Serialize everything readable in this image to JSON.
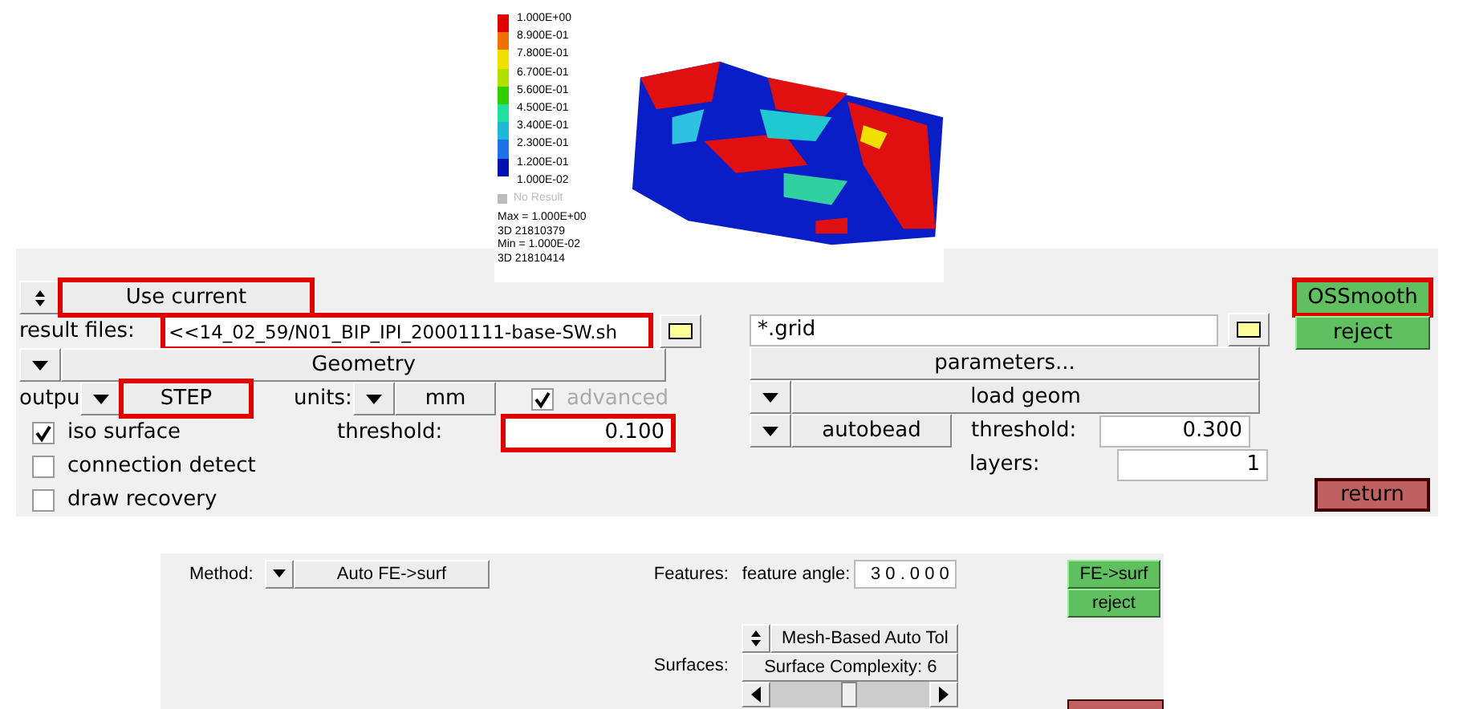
{
  "contour_plot": {
    "legend_labels": [
      "1.000E+00",
      "8.900E-01",
      "7.800E-01",
      "6.700E-01",
      "5.600E-01",
      "4.500E-01",
      "3.400E-01",
      "2.300E-01",
      "1.200E-01",
      "1.000E-02"
    ],
    "legend_bands": [
      {
        "color": "#e00000"
      },
      {
        "color": "#f07000"
      },
      {
        "color": "#f0e000"
      },
      {
        "color": "#b0e000"
      },
      {
        "color": "#30d000"
      },
      {
        "color": "#20e0a0"
      },
      {
        "color": "#20b8d8"
      },
      {
        "color": "#2070e8"
      },
      {
        "color": "#0010b0"
      }
    ],
    "no_result": "No Result",
    "stats": [
      "Max = 1.000E+00",
      "3D 21810379",
      "Min = 1.000E-02",
      "3D 21810414"
    ]
  },
  "osmooth_panel": {
    "mode_button": {
      "label": "Use current",
      "highlighted": true
    },
    "result_files": {
      "label": "result files:",
      "value": "<<14_02_59/N01_BIP_IPI_20001111-base-SW.sh",
      "highlighted": true
    },
    "geometry_button": "Geometry",
    "output": {
      "label": "outpu",
      "value": "STEP",
      "highlighted": true
    },
    "units": {
      "label": "units:",
      "value": "mm"
    },
    "advanced": {
      "label": "advanced",
      "checked": true,
      "disabled": true
    },
    "options": [
      {
        "label": "iso surface",
        "checked": true
      },
      {
        "label": "connection detect",
        "checked": false
      },
      {
        "label": "draw recovery",
        "checked": false
      }
    ],
    "threshold": {
      "label": "threshold:",
      "value": "0.100",
      "highlighted": true
    },
    "grid_field": {
      "value": "*.grid"
    },
    "parameters_button": "parameters...",
    "load_geom_button": "load geom",
    "autobead_button": "autobead",
    "bead_threshold": {
      "label": "threshold:",
      "value": "0.300"
    },
    "layers": {
      "label": "layers:",
      "value": "1"
    },
    "actions": [
      {
        "label": "OSSmooth",
        "highlighted": true
      },
      {
        "label": "reject",
        "highlighted": false
      }
    ],
    "return_button": "return"
  },
  "autosurf_panel": {
    "method": {
      "label": "Method:",
      "value": "Auto FE->surf"
    },
    "features": {
      "label": "Features:",
      "field_label": "feature angle:",
      "value": "3 0 . 0 0 0"
    },
    "actions": [
      "FE->surf",
      "reject"
    ],
    "surfaces": {
      "label": "Surfaces:",
      "value": "Mesh-Based Auto Tol",
      "complexity": "Surface Complexity: 6",
      "level": 0.5
    }
  }
}
